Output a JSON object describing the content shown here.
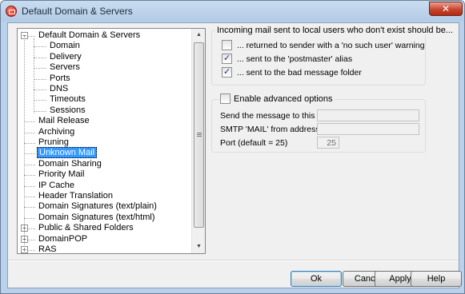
{
  "window": {
    "title": "Default Domain & Servers"
  },
  "tree": {
    "items": [
      {
        "label": "Default Domain & Servers",
        "level": 0,
        "expander": "−"
      },
      {
        "label": "Domain",
        "level": 1
      },
      {
        "label": "Delivery",
        "level": 1
      },
      {
        "label": "Servers",
        "level": 1
      },
      {
        "label": "Ports",
        "level": 1
      },
      {
        "label": "DNS",
        "level": 1
      },
      {
        "label": "Timeouts",
        "level": 1
      },
      {
        "label": "Sessions",
        "level": 1
      },
      {
        "label": "Mail Release",
        "level": 0
      },
      {
        "label": "Archiving",
        "level": 0
      },
      {
        "label": "Pruning",
        "level": 0
      },
      {
        "label": "Unknown Mail",
        "level": 0,
        "selected": true
      },
      {
        "label": "Domain Sharing",
        "level": 0
      },
      {
        "label": "Priority Mail",
        "level": 0
      },
      {
        "label": "IP Cache",
        "level": 0
      },
      {
        "label": "Header Translation",
        "level": 0
      },
      {
        "label": "Domain Signatures (text/plain)",
        "level": 0
      },
      {
        "label": "Domain Signatures (text/html)",
        "level": 0
      },
      {
        "label": "Public & Shared Folders",
        "level": 0,
        "expander": "+"
      },
      {
        "label": "DomainPOP",
        "level": 0,
        "expander": "+"
      },
      {
        "label": "RAS",
        "level": 0,
        "expander": "+"
      }
    ]
  },
  "unknown_mail": {
    "group_title": "Incoming mail sent to local users who don't exist should be...",
    "options": [
      {
        "label": "... returned to sender with a 'no such user' warning",
        "checked": false
      },
      {
        "label": "... sent to the 'postmaster' alias",
        "checked": true
      },
      {
        "label": "... sent to the bad message folder",
        "checked": true
      }
    ]
  },
  "advanced": {
    "enable_label": "Enable advanced options",
    "enabled": false,
    "host_label": "Send the message to this host",
    "host_value": "",
    "smtp_label": "SMTP 'MAIL' from address",
    "smtp_value": "",
    "port_label": "Port (default = 25)",
    "port_value": "25"
  },
  "buttons": {
    "ok": "Ok",
    "cancel": "Cancel",
    "apply": "Apply",
    "help": "Help"
  },
  "colors": {
    "selection": "#3399ff",
    "titlebar": "#b9d1ea",
    "close": "#c9452e"
  }
}
